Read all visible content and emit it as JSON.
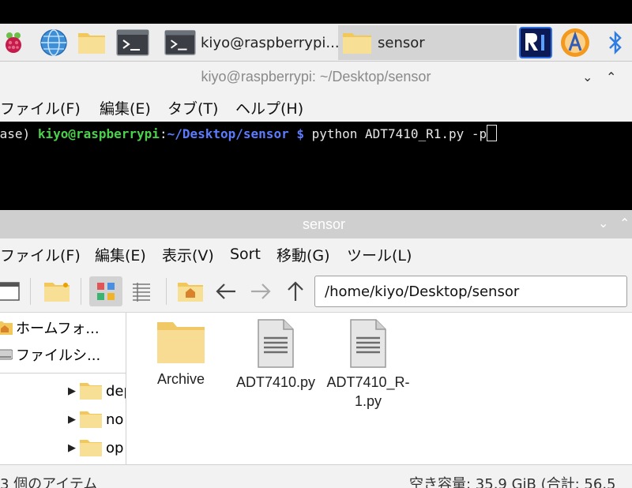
{
  "taskbar": {
    "tasks": [
      {
        "label": "kiyo@raspberrypi..."
      },
      {
        "label": "sensor"
      }
    ]
  },
  "terminal": {
    "title": "kiyo@raspberrypi: ~/Desktop/sensor",
    "menu": [
      "ファイル(F)",
      "編集(E)",
      "タブ(T)",
      "ヘルプ(H)"
    ],
    "prompt_env": "base)",
    "prompt_user": "kiyo@raspberrypi",
    "prompt_sep": ":",
    "prompt_path": "~/Desktop/sensor $",
    "command": "python ADT7410_R1.py -p"
  },
  "file_manager": {
    "title": "sensor",
    "menu": [
      "ファイル(F)",
      "編集(E)",
      "表示(V)",
      "Sort",
      "移動(G)",
      "ツール(L)"
    ],
    "path": "/home/kiyo/Desktop/sensor",
    "places": [
      "ホームフォ...",
      "ファイルシ..."
    ],
    "tree": [
      "dep",
      "no",
      "op"
    ],
    "files": [
      {
        "name": "Archive",
        "type": "folder"
      },
      {
        "name": "ADT7410.py",
        "type": "file"
      },
      {
        "name": "ADT7410_R-\n1.py",
        "type": "file"
      }
    ],
    "status_left": "3 個のアイテム",
    "status_right": "空き容量: 35.9 GiB (合計: 56.5"
  },
  "colors": {
    "prompt_user": "#4bd14b",
    "prompt_path": "#5d7bff",
    "folder": "#f5d57a"
  }
}
